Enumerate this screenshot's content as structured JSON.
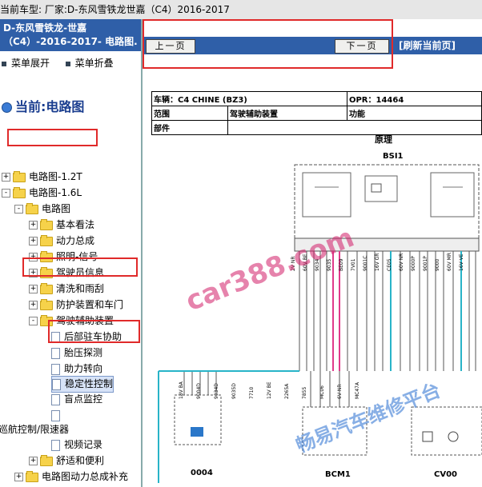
{
  "title": "当前车型:   厂家:D-东风雪铁龙世嘉（C4）2016-2017",
  "left": {
    "header": "D-东风雪铁龙-世嘉（C4）-2016-2017- 电路图.",
    "expand": "菜单展开",
    "collapse": "菜单折叠",
    "current": "当前:电路图",
    "tree": [
      {
        "label": "电路图-1.2T",
        "level": 0,
        "type": "folder",
        "pm": "+"
      },
      {
        "label": "电路图-1.6L",
        "level": 0,
        "type": "folder",
        "pm": "-"
      },
      {
        "label": "电路图",
        "level": 1,
        "type": "folder",
        "pm": "-"
      },
      {
        "label": "基本看法",
        "level": 2,
        "type": "folder",
        "pm": "+"
      },
      {
        "label": "动力总成",
        "level": 2,
        "type": "folder",
        "pm": "+"
      },
      {
        "label": "照明-信号",
        "level": 2,
        "type": "folder",
        "pm": "+"
      },
      {
        "label": "驾驶员信息",
        "level": 2,
        "type": "folder",
        "pm": "+"
      },
      {
        "label": "清洗和雨刮",
        "level": 2,
        "type": "folder",
        "pm": "+"
      },
      {
        "label": "防护装置和车门",
        "level": 2,
        "type": "folder",
        "pm": "+"
      },
      {
        "label": "驾驶辅助装置",
        "level": 2,
        "type": "folder",
        "pm": "-"
      },
      {
        "label": "后部驻车协助",
        "level": 3,
        "type": "doc"
      },
      {
        "label": "胎压探测",
        "level": 3,
        "type": "doc"
      },
      {
        "label": "助力转向",
        "level": 3,
        "type": "doc"
      },
      {
        "label": "稳定性控制",
        "level": 3,
        "type": "doc",
        "selected": true
      },
      {
        "label": "盲点监控",
        "level": 3,
        "type": "doc"
      },
      {
        "label": "",
        "level": 3,
        "type": "doc"
      },
      {
        "label": "巡航控制/限速器",
        "level": -1,
        "type": "text"
      },
      {
        "label": "视频记录",
        "level": 3,
        "type": "doc"
      },
      {
        "label": "舒适和便利",
        "level": 2,
        "type": "folder",
        "pm": "+"
      },
      {
        "label": "电路图动力总成补充",
        "level": 1,
        "type": "folder",
        "pm": "+"
      }
    ]
  },
  "nav": {
    "prev": "上一页",
    "next": "下一页",
    "refresh": "[刷新当前页]"
  },
  "info": {
    "vehicle": "车辆：C4 CHINE (BZ3)",
    "opr": "OPR：14464",
    "scope_label": "范围",
    "scope_value": "驾驶辅助装置",
    "function_label": "功能",
    "part_label": "部件",
    "principle": "原理"
  },
  "diagram": {
    "labels": [
      "BSI1",
      "0004",
      "BCM1",
      "CV00"
    ],
    "watermarks": [
      "car388.com",
      "畅易汽车维修平台"
    ],
    "wire_codes": [
      "2V NR",
      "60V BE",
      "9034",
      "9035",
      "BE09",
      "7V01",
      "9001C",
      "16V GR",
      "CE05",
      "60V NR",
      "9000P",
      "9001P",
      "9000",
      "60V MR",
      "16V VE",
      "18V BA",
      "9004D",
      "9034D",
      "9035D",
      "7710",
      "12V BE",
      "2265A",
      "7855",
      "MC06",
      "6V NR",
      "MC47A"
    ]
  },
  "colors": {
    "nav_blue": "#2f5fa8",
    "highlight_red": "#e02a2a",
    "wire_pink": "#e03a8a",
    "wire_cyan": "#28b4c8",
    "watermark_blue": "#3a7bd5"
  }
}
